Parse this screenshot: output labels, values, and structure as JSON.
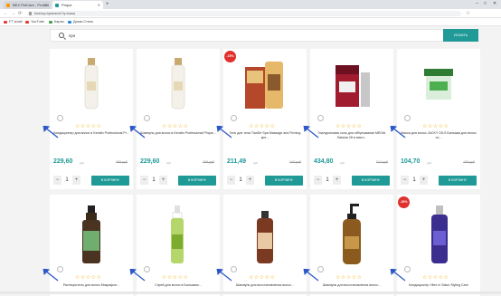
{
  "browser": {
    "tabs": [
      {
        "label": "BEX PetCare - Profilet",
        "active": false,
        "color": "#ff9800"
      },
      {
        "label": "Prique",
        "active": true,
        "color": "#1f9a97"
      }
    ],
    "new_tab": "+",
    "window_controls": [
      "–",
      "□",
      "✕"
    ],
    "nav": [
      "←",
      "→",
      "⟳"
    ],
    "url": "bioshop.by/search/?q=krasa",
    "bookmarks": [
      {
        "label": "FT small",
        "color": "#e53935"
      },
      {
        "label": "YouTube",
        "color": "#e53935"
      },
      {
        "label": "Карты",
        "color": "#43a047"
      },
      {
        "label": "Диски Стиль",
        "color": "#1e88e5"
      }
    ]
  },
  "search": {
    "value": "пря",
    "placeholder": "",
    "button_label": "ИСКАТЬ"
  },
  "colors": {
    "accent": "#1f9a97",
    "badge": "#e0302d",
    "star": "#f2a900",
    "arrow": "#2c58c7"
  },
  "products": [
    {
      "name": "Кондиционер для волос в Keratin Professional Pr...",
      "price": "229,60",
      "unit": "руб",
      "old_price": "289 руб",
      "qty": "1",
      "cart_label": "В КОРЗИНУ",
      "badge": "",
      "image": "white-bottle-icon"
    },
    {
      "name": "Шампунь для волос в Keratin Professional Prique...",
      "price": "229,60",
      "unit": "руб",
      "old_price": "289 руб",
      "qty": "1",
      "cart_label": "В КОРЗИНУ",
      "badge": "",
      "image": "white-bottle-icon"
    },
    {
      "name": "Гель для тела TianDe Spa Massage and Firming кре...",
      "price": "211,49",
      "unit": "руб",
      "old_price": "249 руб",
      "qty": "1",
      "cart_label": "В КОРЗИНУ",
      "badge": "-15%",
      "image": "tubes-box-icon"
    },
    {
      "name": "Гиалуроновая соль для обёртывания MEDIA Sakana Oil в масл...",
      "price": "434,80",
      "unit": "руб",
      "old_price": "512 руб",
      "qty": "1",
      "cart_label": "В КОРЗИНУ",
      "badge": "",
      "image": "jar-icon"
    },
    {
      "name": "Маска для волос JACKY OILS Бальзам для волос оч...",
      "price": "104,70",
      "unit": "руб",
      "old_price": "135 руб",
      "qty": "1",
      "cart_label": "В КОРЗИНУ",
      "badge": "",
      "image": "tub-icon"
    },
    {
      "name": "Растворитель для волос Микрафон...",
      "badge": "",
      "image": "dark-bottle-icon"
    },
    {
      "name": "Спрей для волос в Бальзамо...",
      "badge": "",
      "image": "spray-bottle-icon"
    },
    {
      "name": "Шампунь для восстановления волос...",
      "badge": "",
      "image": "brown-bottle-icon"
    },
    {
      "name": "Шампунь для восстановления волос...",
      "badge": "",
      "image": "pump-bottle-icon"
    },
    {
      "name": "Кондиционер Vitex in Salon Styling Care",
      "badge": "-20%",
      "image": "purple-bottle-icon"
    }
  ]
}
